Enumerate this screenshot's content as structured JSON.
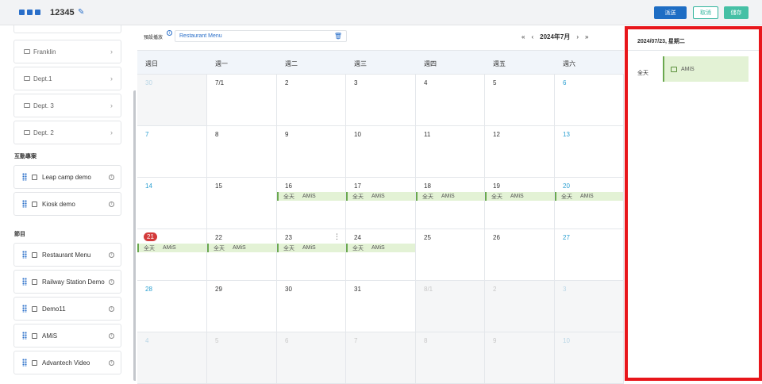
{
  "header": {
    "title": "12345",
    "publish": "派送",
    "cancel": "取消",
    "save": "儲存"
  },
  "sidebar": {
    "folders": [
      "Franklin",
      "Dept.1",
      "Dept. 3",
      "Dept. 2"
    ],
    "section_interactive": "互動專案",
    "interactive": [
      "Leap camp demo",
      "Kiosk demo"
    ],
    "section_programs": "節目",
    "programs": [
      "Restaurant Menu",
      "Railway Station Demo",
      "Demo11",
      "AMiS",
      "Advantech Video"
    ]
  },
  "calendar": {
    "preset_label": "預設播放",
    "preset_value": "Restaurant Menu",
    "month": "2024年7月",
    "nav": {
      "first": "«",
      "prev": "‹",
      "next": "›",
      "last": "»"
    },
    "weekdays": [
      "週日",
      "週一",
      "週二",
      "週三",
      "週四",
      "週五",
      "週六"
    ],
    "weeks": [
      [
        "30",
        "7/1",
        "2",
        "3",
        "4",
        "5",
        "6"
      ],
      [
        "7",
        "8",
        "9",
        "10",
        "11",
        "12",
        "13"
      ],
      [
        "14",
        "15",
        "16",
        "17",
        "18",
        "19",
        "20"
      ],
      [
        "21",
        "22",
        "23",
        "24",
        "25",
        "26",
        "27"
      ],
      [
        "28",
        "29",
        "30",
        "31",
        "8/1",
        "2",
        "3"
      ],
      [
        "4",
        "5",
        "6",
        "7",
        "8",
        "9",
        "10"
      ]
    ],
    "event_allday": "全天",
    "event_name": "AMiS",
    "more": "⋮"
  },
  "detail": {
    "date": "2024/07/23, 星期二",
    "allday": "全天",
    "event": "AMiS"
  }
}
